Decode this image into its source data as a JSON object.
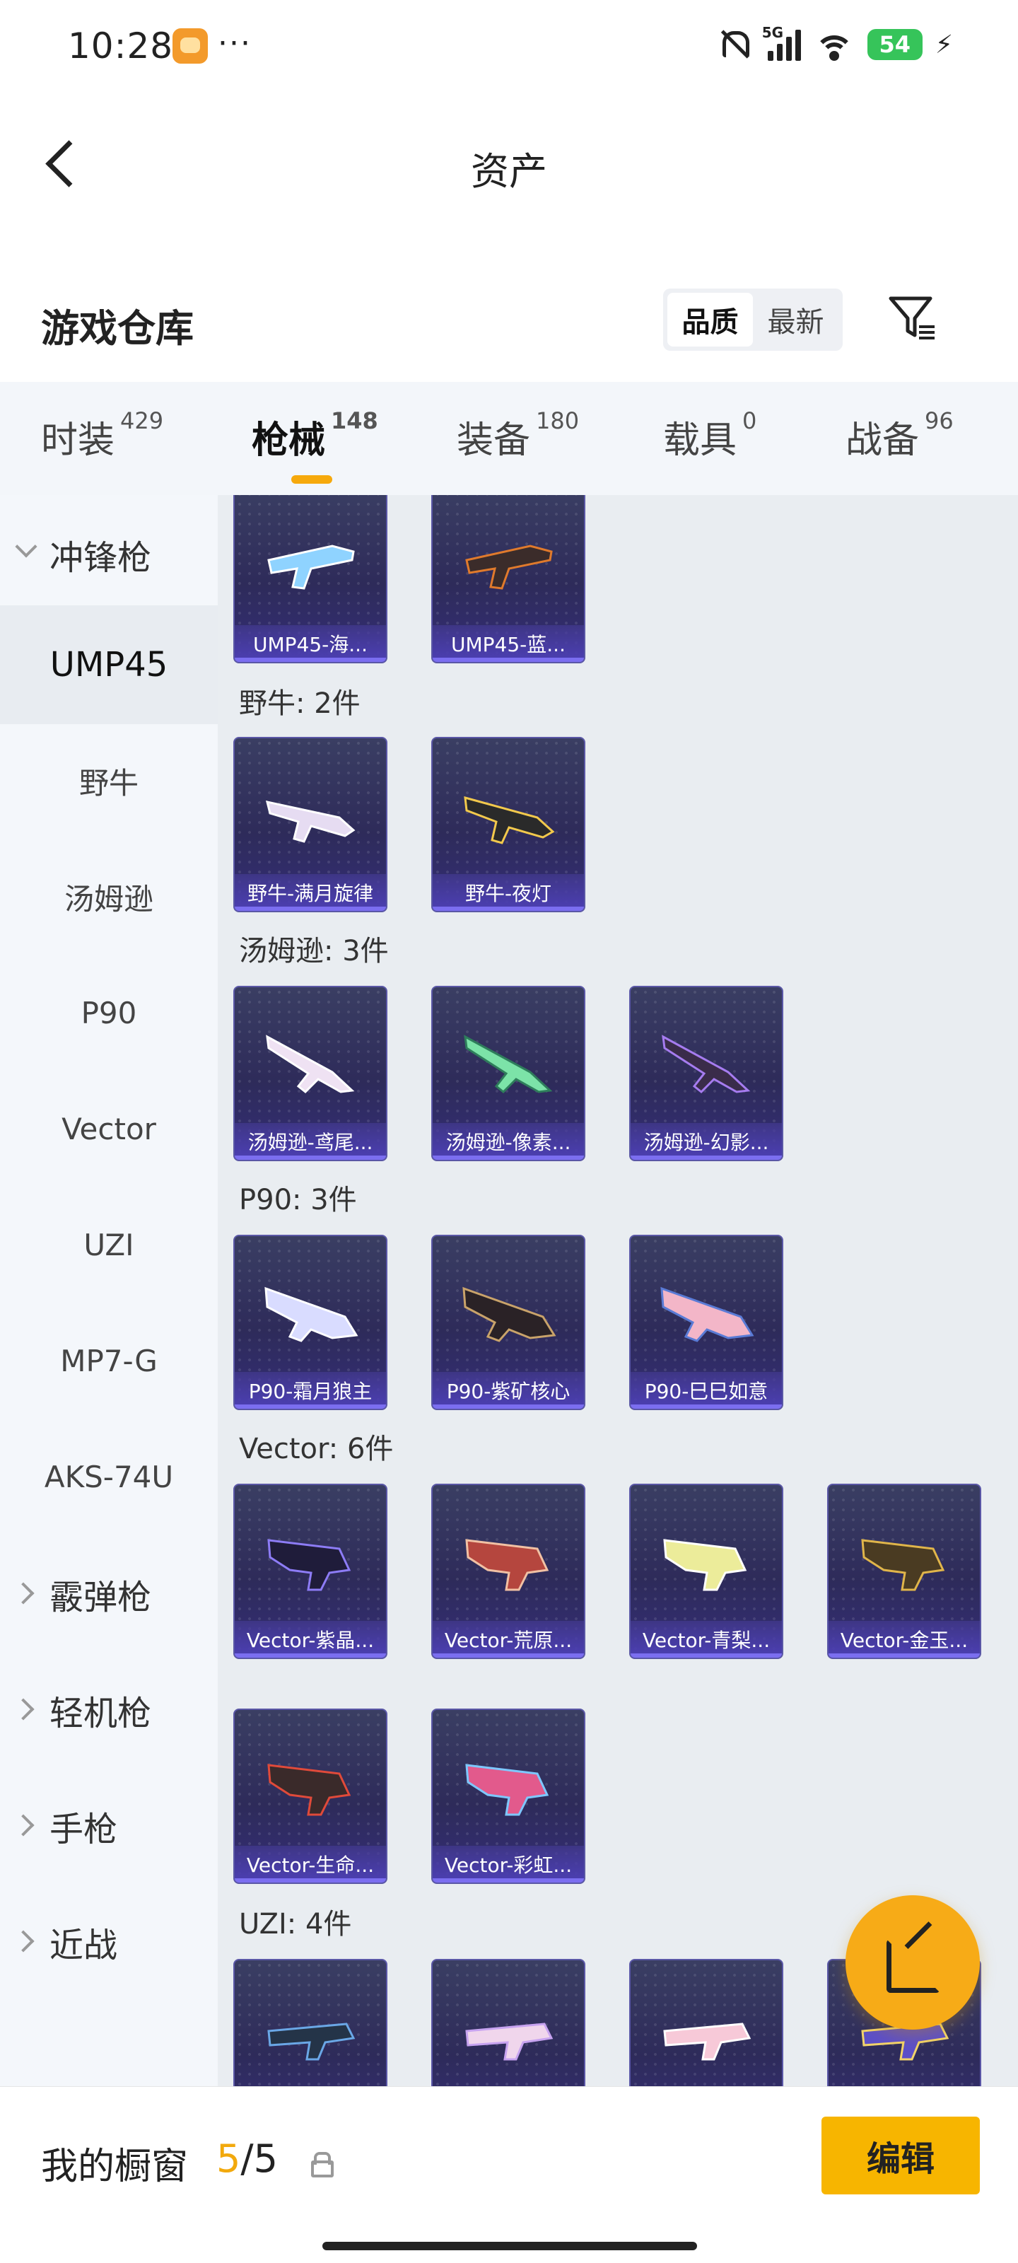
{
  "status": {
    "time": "10:28",
    "battery": "54",
    "network": "5G",
    "more": "···"
  },
  "header": {
    "title": "资产"
  },
  "warehouse": {
    "title": "游戏仓库",
    "sort_options": [
      "品质",
      "最新"
    ]
  },
  "tabs": [
    {
      "label": "时装",
      "count": "429"
    },
    {
      "label": "枪械",
      "count": "148"
    },
    {
      "label": "装备",
      "count": "180"
    },
    {
      "label": "载具",
      "count": "0"
    },
    {
      "label": "战备",
      "count": "96"
    }
  ],
  "sidebar": {
    "items": [
      {
        "label": "冲锋枪"
      },
      {
        "label": "UMP45"
      },
      {
        "label": "野牛"
      },
      {
        "label": "汤姆逊"
      },
      {
        "label": "P90"
      },
      {
        "label": "Vector"
      },
      {
        "label": "UZI"
      },
      {
        "label": "MP7-G"
      },
      {
        "label": "AKS-74U"
      },
      {
        "label": "霰弹枪"
      },
      {
        "label": "轻机枪"
      },
      {
        "label": "手枪"
      },
      {
        "label": "近战"
      }
    ]
  },
  "sections": [
    {
      "title": "",
      "items": [
        "UMP45-海...",
        "UMP45-蓝..."
      ]
    },
    {
      "title": "野牛: 2件",
      "items": [
        "野牛-满月旋律",
        "野牛-夜灯"
      ]
    },
    {
      "title": "汤姆逊: 3件",
      "items": [
        "汤姆逊-鸢尾...",
        "汤姆逊-像素...",
        "汤姆逊-幻影..."
      ]
    },
    {
      "title": "P90: 3件",
      "items": [
        "P90-霜月狼主",
        "P90-紫矿核心",
        "P90-巳巳如意"
      ]
    },
    {
      "title": "Vector: 6件",
      "items": [
        "Vector-紫晶...",
        "Vector-荒原...",
        "Vector-青梨...",
        "Vector-金玉...",
        "Vector-生命...",
        "Vector-彩虹..."
      ]
    },
    {
      "title": "UZI: 4件",
      "items": [
        "",
        "",
        "",
        ""
      ]
    }
  ],
  "colors": {
    "accent": "#f6a90c",
    "card": "#2f2c5c",
    "card_label": "#4c3fb3"
  },
  "showcase": {
    "label": "我的橱窗",
    "current": "5",
    "total": "5",
    "edit_label": "编辑"
  }
}
